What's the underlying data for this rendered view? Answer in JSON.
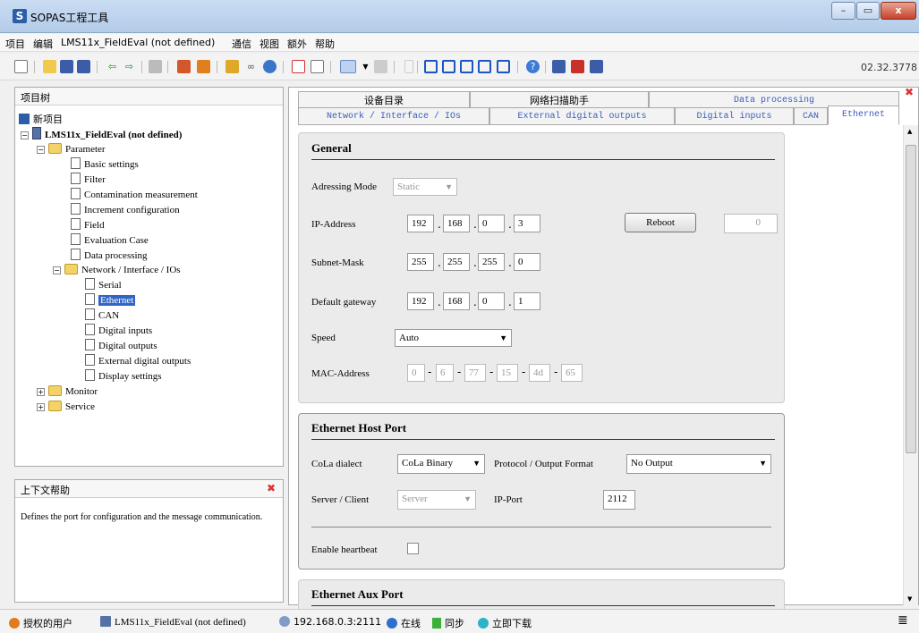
{
  "window": {
    "title": "SOPAS工程工具",
    "logo": "S"
  },
  "window_controls": {
    "minimize": "–",
    "maximize": "▭",
    "close": "x"
  },
  "menu": [
    "项目",
    "编辑",
    "LMS11x_FieldEval (not defined)",
    "通信",
    "视图",
    "额外",
    "帮助"
  ],
  "toolbar": {
    "version": "02.32.3778"
  },
  "tree": {
    "title": "项目树",
    "root": "新项目",
    "device": "LMS11x_FieldEval (not defined)",
    "parameter": "Parameter",
    "parameter_items": [
      "Basic settings",
      "Filter",
      "Contamination measurement",
      "Increment configuration",
      "Field",
      "Evaluation Case",
      "Data processing"
    ],
    "network": "Network / Interface / IOs",
    "network_items": [
      "Serial",
      "Ethernet",
      "CAN",
      "Digital inputs",
      "Digital outputs",
      "External digital outputs",
      "Display settings"
    ],
    "monitor": "Monitor",
    "service": "Service"
  },
  "help": {
    "title": "上下文帮助",
    "text": "Defines the port for configuration and the message communication."
  },
  "tabs_top": [
    "设备目录",
    "网络扫描助手",
    "Data processing"
  ],
  "tabs_bottom": [
    "Network / Interface / IOs",
    "External digital outputs",
    "Digital inputs",
    "CAN",
    "Ethernet"
  ],
  "general": {
    "title": "General",
    "addressing_label": "Adressing Mode",
    "addressing_value": "Static",
    "ip_label": "IP-Address",
    "ip": [
      "192",
      "168",
      "0",
      "3"
    ],
    "reboot_label": "Reboot",
    "reboot_value": "0",
    "mask_label": "Subnet-Mask",
    "mask": [
      "255",
      "255",
      "255",
      "0"
    ],
    "gateway_label": "Default gateway",
    "gateway": [
      "192",
      "168",
      "0",
      "1"
    ],
    "speed_label": "Speed",
    "speed_value": "Auto",
    "mac_label": "MAC-Address",
    "mac": [
      "0",
      "6",
      "77",
      "15",
      "4d",
      "65"
    ]
  },
  "host_port": {
    "title": "Ethernet Host Port",
    "cola_label": "CoLa dialect",
    "cola_value": "CoLa Binary",
    "protocol_label": "Protocol / Output Format",
    "protocol_value": "No Output",
    "server_label": "Server / Client",
    "server_value": "Server",
    "port_label": "IP-Port",
    "port_value": "2112",
    "heartbeat_label": "Enable heartbeat"
  },
  "aux_port": {
    "title": "Ethernet Aux Port"
  },
  "status": {
    "user": "授权的用户",
    "device": "LMS11x_FieldEval (not defined)",
    "address": "192.168.0.3:2111",
    "online": "在线",
    "sync": "同步",
    "download": "立即下载"
  }
}
